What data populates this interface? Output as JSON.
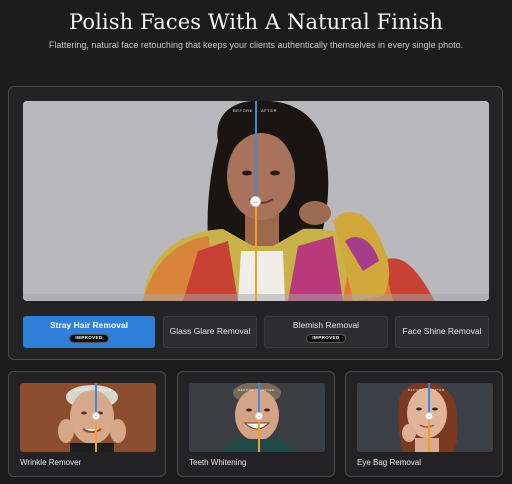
{
  "header": {
    "title": "Polish Faces With A Natural Finish",
    "subtitle": "Flattering, natural face retouching that keeps your clients authentically themselves in every single photo."
  },
  "hero": {
    "before_label": "BEFORE",
    "after_label": "AFTER",
    "handle_icon": "drag-arrows-icon"
  },
  "tabs": [
    {
      "label": "Stray Hair Removal",
      "badge": "IMPROVED",
      "active": true
    },
    {
      "label": "Glass Glare Removal",
      "badge": "",
      "active": false
    },
    {
      "label": "Blemish Removal",
      "badge": "IMPROVED",
      "active": false
    },
    {
      "label": "Face Shine Removal",
      "badge": "",
      "active": false
    }
  ],
  "cards": [
    {
      "label": "Wrinkle Remover",
      "before_label": "BEFORE",
      "after_label": "AFTER"
    },
    {
      "label": "Teeth Whitening",
      "before_label": "BEFORE",
      "after_label": "AFTER"
    },
    {
      "label": "Eye Bag Removal",
      "before_label": "BEFORE",
      "after_label": "AFTER"
    }
  ],
  "colors": {
    "accent": "#2f7ed8",
    "split_after": "#f0a227",
    "split_before": "#3d8bde",
    "background": "#1c1c1d"
  }
}
